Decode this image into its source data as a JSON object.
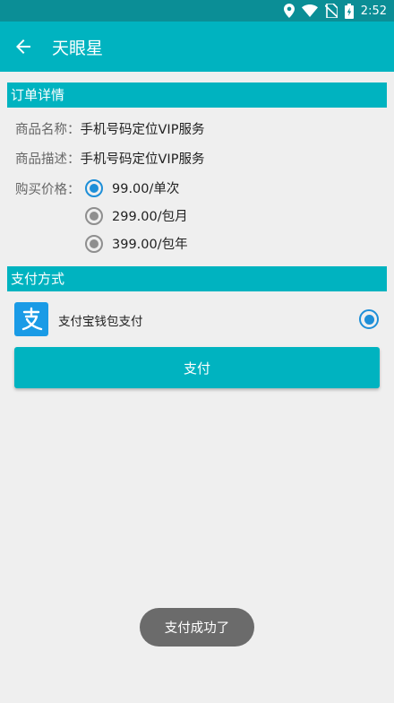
{
  "statusbar": {
    "time": "2:52",
    "icons": [
      "location-icon",
      "wifi-icon",
      "no-sim-icon",
      "battery-icon"
    ]
  },
  "appbar": {
    "title": "天眼星",
    "back_icon": "arrow-left-icon"
  },
  "order": {
    "header": "订单详情",
    "name_label": "商品名称：",
    "name_value": "手机号码定位VIP服务",
    "desc_label": "商品描述：",
    "desc_value": "手机号码定位VIP服务",
    "price_label": "购买价格：",
    "price_options": [
      {
        "label": "99.00/单次",
        "selected": true
      },
      {
        "label": "299.00/包月",
        "selected": false
      },
      {
        "label": "399.00/包年",
        "selected": false
      }
    ]
  },
  "payment": {
    "header": "支付方式",
    "method_label": "支付宝钱包支付",
    "logo_icon": "alipay-icon",
    "selected": true,
    "button_label": "支付"
  },
  "toast": {
    "message": "支付成功了"
  },
  "colors": {
    "primary": "#00b3c0",
    "statusbar": "#0b8e96",
    "radio_selected": "#1e8fd8",
    "background": "#efefef"
  }
}
